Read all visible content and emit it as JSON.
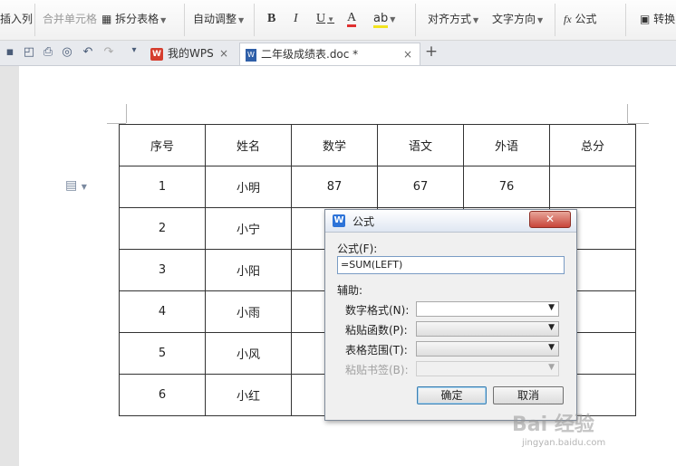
{
  "ribbon": {
    "insert_col": "插入列",
    "merge_cells": "合并单元格",
    "split_table": "拆分表格",
    "auto_adjust": "自动调整",
    "bold": "B",
    "italic": "I",
    "underline": "U",
    "font_color": "A",
    "align": "对齐方式",
    "text_dir": "文字方向",
    "formula_fx": "fx",
    "formula": "公式",
    "convert": "转换"
  },
  "tabs": [
    {
      "label": "我的WPS",
      "logo": "W"
    },
    {
      "label": "二年级成绩表.doc *",
      "logo": "W"
    }
  ],
  "table": {
    "header": [
      "序号",
      "姓名",
      "数学",
      "语文",
      "外语",
      "总分"
    ],
    "rows": [
      [
        "1",
        "小明",
        "87",
        "67",
        "76",
        ""
      ],
      [
        "2",
        "小宁",
        "",
        "",
        "",
        ""
      ],
      [
        "3",
        "小阳",
        "",
        "",
        "",
        ""
      ],
      [
        "4",
        "小雨",
        "",
        "",
        "",
        ""
      ],
      [
        "5",
        "小风",
        "",
        "",
        "",
        ""
      ],
      [
        "6",
        "小红",
        "",
        "",
        "",
        ""
      ]
    ]
  },
  "dialog": {
    "logo": "W",
    "title": "公式",
    "close": "关闭",
    "formula_label": "公式(F):",
    "formula_value": "=SUM(LEFT)",
    "assist_label": "辅助:",
    "num_format_label": "数字格式(N):",
    "paste_func_label": "粘贴函数(P):",
    "table_range_label": "表格范围(T):",
    "paste_bookmark_label": "粘贴书签(B):",
    "ok": "确定",
    "cancel": "取消"
  },
  "watermark": {
    "text": "Bai 经验",
    "url": "jingyan.baidu.com"
  }
}
